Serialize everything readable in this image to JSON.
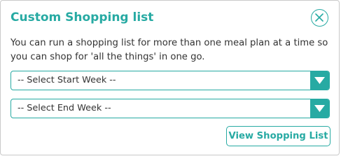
{
  "modal": {
    "title": "Custom Shopping list",
    "description": "You can run a shopping list for more than one meal plan at a time so you can shop for 'all the things' in one go.",
    "close_icon": "close-circle-icon",
    "start_week_select": {
      "selected": "-- Select Start Week --",
      "arrow_icon": "triangle-down-icon"
    },
    "end_week_select": {
      "selected": "-- Select End Week --",
      "arrow_icon": "triangle-down-icon"
    },
    "view_button_label": "View Shopping List"
  },
  "colors": {
    "accent": "#27aaa3",
    "text": "#333333",
    "border": "#c9c9c9"
  }
}
